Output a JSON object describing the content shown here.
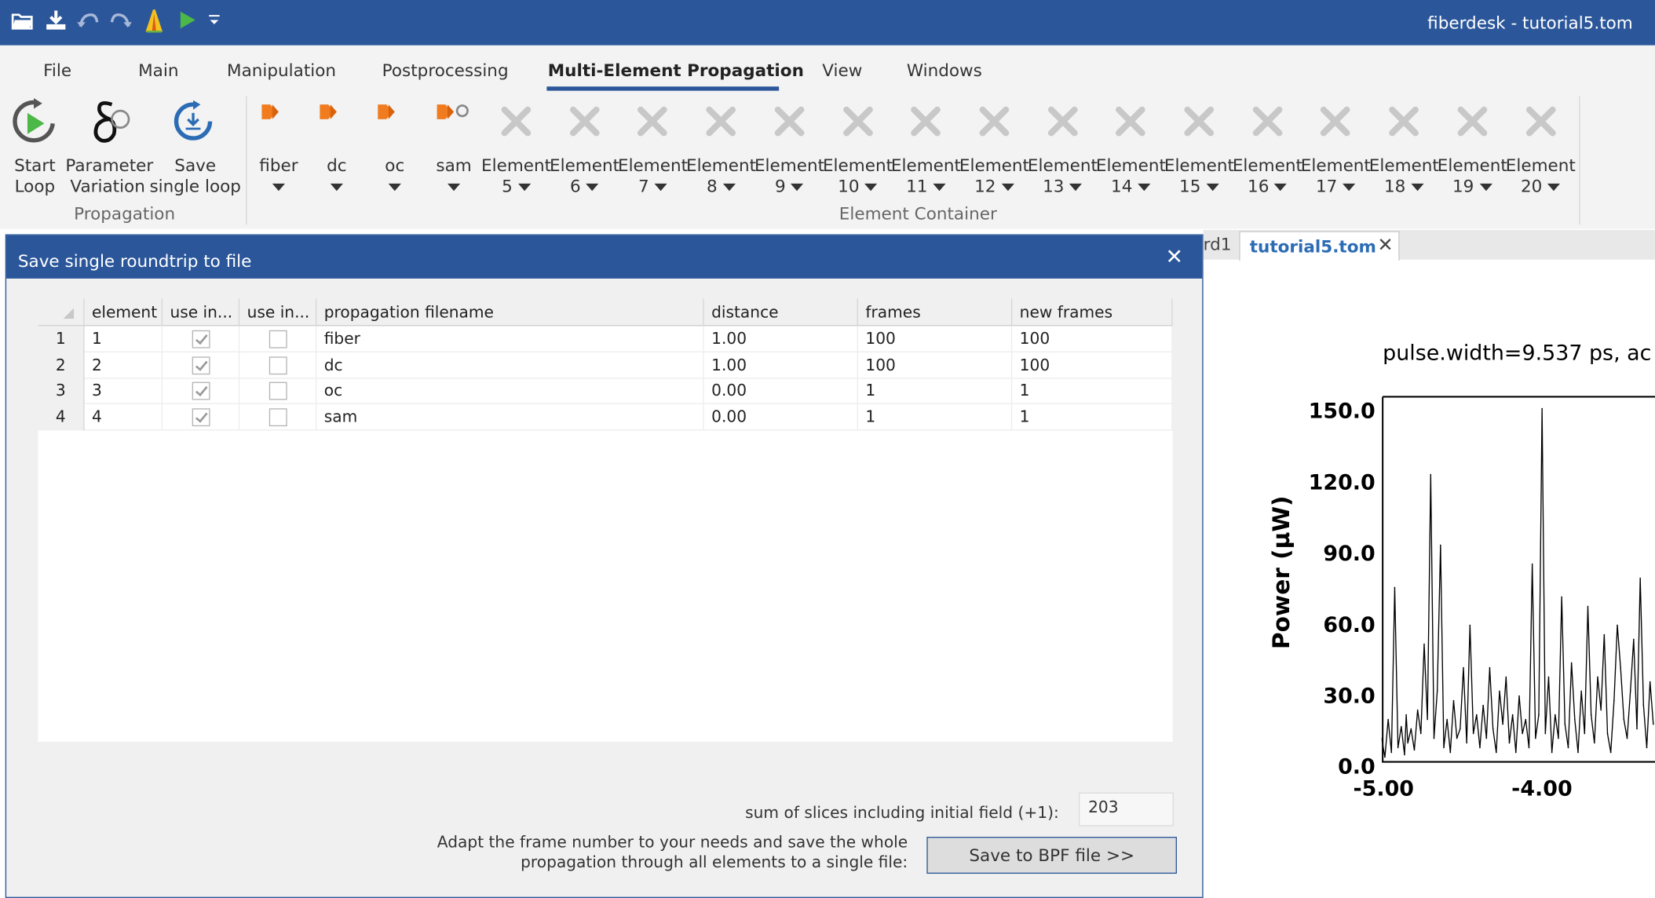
{
  "app": {
    "title": "fiberdesk - tutorial5.tom"
  },
  "quick_access": [
    "open-folder-icon",
    "download-icon",
    "undo-icon",
    "redo-icon",
    "spectrum-icon",
    "play-icon",
    "customize-icon"
  ],
  "menu": {
    "tabs": [
      "File",
      "Main",
      "Manipulation",
      "Postprocessing",
      "Multi-Element Propagation",
      "View",
      "Windows"
    ],
    "active": "Multi-Element Propagation"
  },
  "ribbon": {
    "propagation": {
      "label": "Propagation",
      "start_loop": [
        "Start",
        "Loop"
      ],
      "parameter_variation": [
        "Parameter",
        "Variation"
      ],
      "save_single_loop": [
        "Save",
        "single loop"
      ]
    },
    "element_container": {
      "label": "Element Container",
      "named": [
        "fiber",
        "dc",
        "oc",
        "sam"
      ],
      "element_word": "Element",
      "numbers": [
        "5",
        "6",
        "7",
        "8",
        "9",
        "10",
        "11",
        "12",
        "13",
        "14",
        "15",
        "16",
        "17",
        "18",
        "19",
        "20"
      ]
    }
  },
  "doc_tabs": {
    "prev_partial": "rd1",
    "active": "tutorial5.tom"
  },
  "plot": {
    "title": "pulse.width=9.537 ps,  ac",
    "ylabel": "Power (µW)",
    "yticks": [
      "150.0",
      "120.0",
      "90.0",
      "60.0",
      "30.0",
      "0.0"
    ],
    "xticks": [
      "-5.00",
      "-4.00"
    ]
  },
  "chart_data": {
    "type": "line",
    "title": "pulse.width=9.537 ps,  ac",
    "ylabel": "Power (µW)",
    "xlabel": "",
    "xlim": [
      -5.0,
      -3.33
    ],
    "ylim": [
      0,
      155
    ],
    "x": [
      -5.0,
      -4.98,
      -4.96,
      -4.94,
      -4.92,
      -4.9,
      -4.88,
      -4.86,
      -4.85,
      -4.84,
      -4.82,
      -4.8,
      -4.78,
      -4.76,
      -4.74,
      -4.72,
      -4.7,
      -4.68,
      -4.66,
      -4.64,
      -4.62,
      -4.6,
      -4.58,
      -4.56,
      -4.54,
      -4.52,
      -4.5,
      -4.48,
      -4.46,
      -4.44,
      -4.42,
      -4.4,
      -4.38,
      -4.36,
      -4.34,
      -4.32,
      -4.3,
      -4.28,
      -4.26,
      -4.24,
      -4.22,
      -4.2,
      -4.18,
      -4.16,
      -4.14,
      -4.12,
      -4.1,
      -4.08,
      -4.06,
      -4.04,
      -4.02,
      -4.0,
      -3.98,
      -3.96,
      -3.94,
      -3.92,
      -3.9,
      -3.88,
      -3.86,
      -3.84,
      -3.82,
      -3.8,
      -3.78,
      -3.76,
      -3.74,
      -3.72,
      -3.7,
      -3.68,
      -3.66,
      -3.64,
      -3.62,
      -3.6,
      -3.58,
      -3.56,
      -3.54,
      -3.52,
      -3.5,
      -3.48,
      -3.46,
      -3.44,
      -3.42,
      -3.4,
      -3.38,
      -3.36,
      -3.34
    ],
    "y": [
      10,
      2,
      18,
      4,
      74,
      6,
      15,
      3,
      20,
      8,
      14,
      5,
      22,
      12,
      50,
      18,
      122,
      10,
      30,
      92,
      6,
      18,
      4,
      26,
      10,
      14,
      40,
      8,
      58,
      12,
      20,
      6,
      24,
      10,
      40,
      14,
      4,
      30,
      16,
      36,
      8,
      20,
      4,
      28,
      12,
      18,
      6,
      84,
      10,
      20,
      150,
      12,
      36,
      4,
      20,
      10,
      70,
      16,
      6,
      42,
      18,
      4,
      30,
      12,
      66,
      20,
      8,
      36,
      22,
      54,
      12,
      4,
      26,
      58,
      40,
      18,
      10,
      30,
      52,
      14,
      78,
      24,
      6,
      34,
      16
    ]
  },
  "dialog": {
    "title": "Save single roundtrip to file",
    "columns": [
      "element",
      "use in...",
      "use in...",
      "propagation filename",
      "distance",
      "frames",
      "new frames"
    ],
    "rows": [
      {
        "num": "1",
        "element": "1",
        "use1": true,
        "use2": false,
        "filename": "fiber",
        "distance": "1.00",
        "frames": "100",
        "new_frames": "100"
      },
      {
        "num": "2",
        "element": "2",
        "use1": true,
        "use2": false,
        "filename": "dc",
        "distance": "1.00",
        "frames": "100",
        "new_frames": "100"
      },
      {
        "num": "3",
        "element": "3",
        "use1": true,
        "use2": false,
        "filename": "oc",
        "distance": "0.00",
        "frames": "1",
        "new_frames": "1"
      },
      {
        "num": "4",
        "element": "4",
        "use1": true,
        "use2": false,
        "filename": "sam",
        "distance": "0.00",
        "frames": "1",
        "new_frames": "1"
      }
    ],
    "sum_label": "sum of slices including initial field (+1):",
    "sum_value": "203",
    "adapt_text_1": "Adapt the frame number to your needs and save the whole",
    "adapt_text_2": "propagation through all elements to a single file:",
    "save_button": "Save to BPF file >>"
  },
  "colors": {
    "accent": "#2b579a",
    "arrow_orange": "#f07c1f",
    "disabled_x": "#c8c8c8",
    "link_blue": "#2b6cb5"
  }
}
